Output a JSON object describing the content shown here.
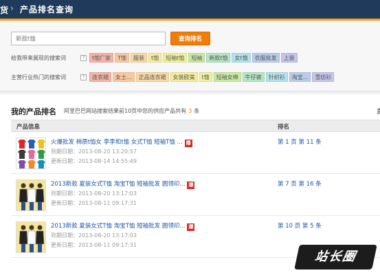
{
  "header": {
    "breadcrumb_prev": "货",
    "separator": "›",
    "title": "产品排名查询"
  },
  "search": {
    "value": "新款t恤",
    "button_label": "查询排名"
  },
  "keywords_unranked": {
    "label": "给我带来展现的搜索词",
    "help": "?",
    "tags": [
      {
        "text": "t恤厂家",
        "color": "#f3b3a6"
      },
      {
        "text": "T恤",
        "color": "#f8c9a0"
      },
      {
        "text": "服装",
        "color": "#f7d9a3"
      },
      {
        "text": "t恤",
        "color": "#f6ea9c"
      },
      {
        "text": "短袖t恤",
        "color": "#eef09a"
      },
      {
        "text": "短袖",
        "color": "#c9e8a2"
      },
      {
        "text": "新款t恤",
        "color": "#b5e5c2"
      },
      {
        "text": "女t恤",
        "color": "#b3e0ea"
      },
      {
        "text": "衣服批发",
        "color": "#b7cdeb"
      },
      {
        "text": "上装",
        "color": "#c5c4ec"
      }
    ]
  },
  "keywords_hot": {
    "label": "主营行业热门的搜索词",
    "help": "?",
    "tags": [
      {
        "text": "连衣裙",
        "color": "#f3b3a6"
      },
      {
        "text": "女士...",
        "color": "#f8c9a0"
      },
      {
        "text": "正品连衣裙",
        "color": "#f7d9a3"
      },
      {
        "text": "女装欧美",
        "color": "#f6ea9c"
      },
      {
        "text": "t恤",
        "color": "#eef09a"
      },
      {
        "text": "短袖女棉",
        "color": "#c9e8a2"
      },
      {
        "text": "牛仔裤",
        "color": "#b5e5c2"
      },
      {
        "text": "针织衫",
        "color": "#b3e0ea"
      },
      {
        "text": "淘宝...",
        "color": "#b7cdeb"
      },
      {
        "text": "雪纺衫",
        "color": "#c5c4ec"
      }
    ]
  },
  "ranking": {
    "title": "我的产品排名",
    "desc_before": "阿里巴巴网站搜索结果前10页中您的供应产品共有",
    "count": "3",
    "desc_after": "条",
    "right_fragment": "直",
    "col_product": "产品信息",
    "col_rank": "排名",
    "hot_badge": "爆",
    "rows": [
      {
        "name": "火爆批发 棉质t恤女 李李和t恤 女式T恤 短袖T恤 ...",
        "expire": "到期日期：2013-08-20 13:20:57",
        "updated": "更新日期：2013-08-14 14:55:49",
        "rank": "第 1 页 第 11 条"
      },
      {
        "name": "2013新款 夏装女式T恤 淘宝T恤 短袖批发 圆领印...",
        "expire": "到期日期：2013-08-20 13:17:03",
        "updated": "更新日期：2013-08-11 09:17:31",
        "rank": "第 7 页 第 16 条"
      },
      {
        "name": "2013新款 夏装女式T恤 淘宝T恤 短袖批发 圆领印...",
        "expire": "到期日期：2013-08-20 13:17:03",
        "updated": "更新日期：2013-08-11 09:17:31",
        "rank": "第 10 页 第 5 条"
      }
    ]
  },
  "watermark": "站长圈"
}
